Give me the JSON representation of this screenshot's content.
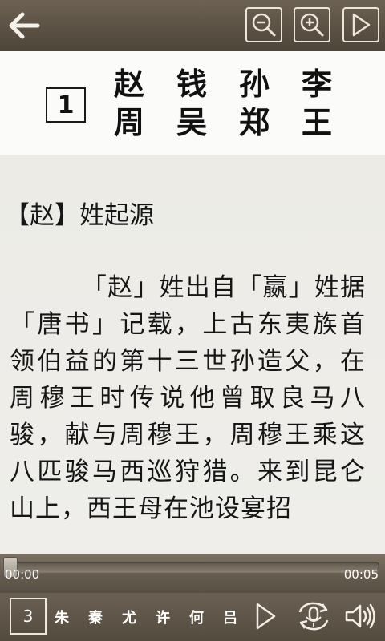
{
  "toolbar": {
    "back_icon": "arrow-left-icon",
    "zoom_out_icon": "zoom-out-icon",
    "zoom_in_icon": "zoom-in-icon",
    "play_icon": "play-icon"
  },
  "lesson": {
    "number": "1",
    "title_chars": [
      "赵",
      "钱",
      "孙",
      "李",
      "周",
      "吴",
      "郑",
      "王"
    ]
  },
  "article": {
    "heading": "【赵】姓起源",
    "paragraph": "「赵」姓出自「嬴」姓据「唐书」记载，上古东夷族首领伯益的第十三世孙造父，在周穆王时传说他曾取良马八骏，献与周穆王，周穆王乘这八匹骏马西巡狩猎。来到昆仑山上，西王母在池设宴招"
  },
  "player": {
    "current_time": "00:00",
    "total_time": "00:05",
    "progress": 0.0
  },
  "bottom": {
    "page": "3",
    "next_chars": [
      "朱",
      "秦",
      "尤",
      "许",
      "何",
      "吕"
    ]
  },
  "colors": {
    "bar_brown": "#5a5043",
    "icon_light": "#ece6da"
  }
}
